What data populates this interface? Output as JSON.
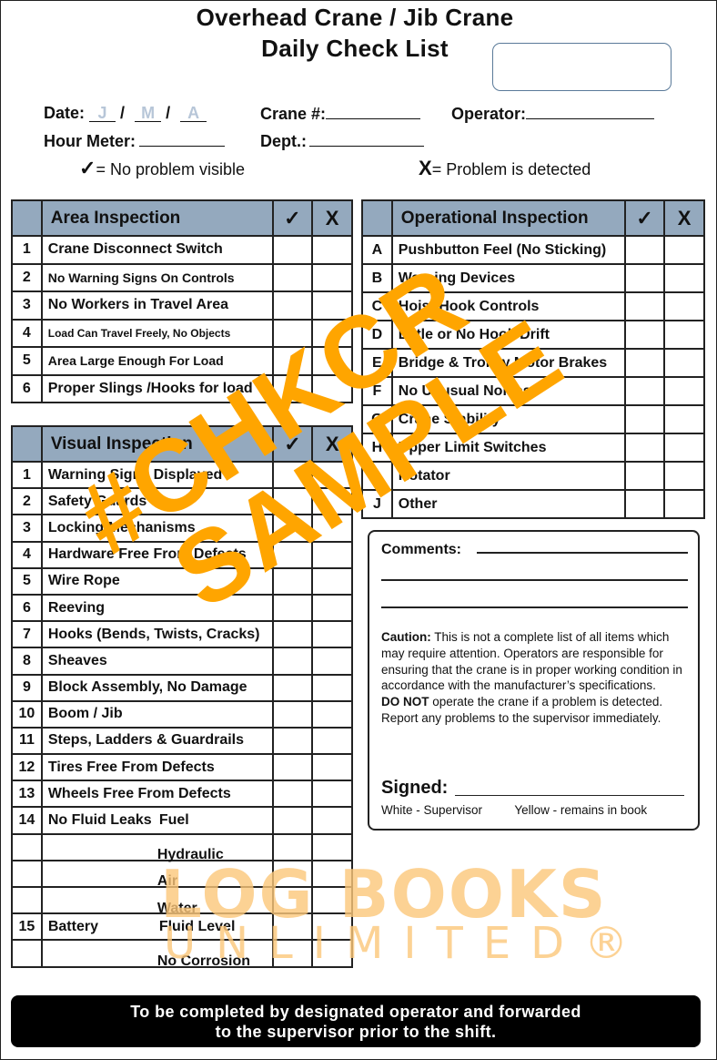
{
  "header": {
    "title_line1": "Overhead Crane / Jib Crane",
    "title_line2": "Daily Check List"
  },
  "fields": {
    "date_label": "Date:",
    "date_day_hint": "J",
    "date_month_hint": "M",
    "date_year_hint": "A",
    "date_separator": "/",
    "crane_label": "Crane #:",
    "operator_label": "Operator:",
    "hour_meter_label": "Hour Meter:",
    "dept_label": "Dept.:"
  },
  "legend": {
    "check_symbol": "✓",
    "check_text": "= No problem visible",
    "x_symbol": "X",
    "x_text": "= Problem is detected"
  },
  "area_inspection": {
    "title": "Area Inspection",
    "check_header": "✓",
    "x_header": "X",
    "rows": [
      {
        "num": "1",
        "label": "Crane Disconnect Switch"
      },
      {
        "num": "2",
        "label": "No Warning Signs On Controls"
      },
      {
        "num": "3",
        "label": "No Workers in Travel Area"
      },
      {
        "num": "4",
        "label": "Load Can Travel Freely, No Objects"
      },
      {
        "num": "5",
        "label": "Area Large Enough For Load"
      },
      {
        "num": "6",
        "label": "Proper Slings /Hooks for load"
      }
    ]
  },
  "operational_inspection": {
    "title": "Operational Inspection",
    "check_header": "✓",
    "x_header": "X",
    "rows": [
      {
        "num": "A",
        "label": "Pushbutton Feel (No Sticking)"
      },
      {
        "num": "B",
        "label": "Warning Devices"
      },
      {
        "num": "C",
        "label": "Hoist Hook Controls"
      },
      {
        "num": "D",
        "label": "Little or No Hook Drift"
      },
      {
        "num": "E",
        "label": "Bridge & Trolley Motor Brakes"
      },
      {
        "num": "F",
        "label": "No Unusual Noises"
      },
      {
        "num": "G",
        "label": "Crane Stability"
      },
      {
        "num": "H",
        "label": "Upper Limit Switches"
      },
      {
        "num": "I",
        "label": "Rotator"
      },
      {
        "num": "J",
        "label": "Other"
      }
    ]
  },
  "visual_inspection": {
    "title": "Visual Inspection",
    "check_header": "✓",
    "x_header": "X",
    "rows": [
      {
        "num": "1",
        "label": "Warning Signs Displayed",
        "sub": ""
      },
      {
        "num": "2",
        "label": "Safety Guards",
        "sub": ""
      },
      {
        "num": "3",
        "label": "Locking Mechanisms",
        "sub": ""
      },
      {
        "num": "4",
        "label": "Hardware Free From Defects",
        "sub": ""
      },
      {
        "num": "5",
        "label": "Wire Rope",
        "sub": ""
      },
      {
        "num": "6",
        "label": "Reeving",
        "sub": ""
      },
      {
        "num": "7",
        "label": "Hooks (Bends, Twists, Cracks)",
        "sub": ""
      },
      {
        "num": "8",
        "label": "Sheaves",
        "sub": ""
      },
      {
        "num": "9",
        "label": "Block Assembly, No Damage",
        "sub": ""
      },
      {
        "num": "10",
        "label": "Boom / Jib",
        "sub": ""
      },
      {
        "num": "11",
        "label": "Steps, Ladders & Guardrails",
        "sub": ""
      },
      {
        "num": "12",
        "label": "Tires Free From Defects",
        "sub": ""
      },
      {
        "num": "13",
        "label": "Wheels Free From Defects",
        "sub": ""
      },
      {
        "num": "14",
        "label": "No Fluid Leaks",
        "sub": "Fuel"
      },
      {
        "num": "",
        "label": "",
        "sub": "Hydraulic"
      },
      {
        "num": "",
        "label": "",
        "sub": "Air"
      },
      {
        "num": "",
        "label": "",
        "sub": "Water"
      },
      {
        "num": "15",
        "label": "Battery",
        "sub": "Fluid Level"
      },
      {
        "num": "",
        "label": "",
        "sub": "No Corrosion"
      }
    ]
  },
  "comments": {
    "label": "Comments:",
    "caution_bold": "Caution:",
    "caution_text": " This is not a complete list of all items which may require attention. Operators are responsible for ensuring that the crane is in proper working condition in accordance with the manufacturer’s specifications.",
    "donot_bold": "DO NOT",
    "donot_text": " operate the crane if a problem is detected. Report any problems to the supervisor immediately.",
    "signed_label": "Signed:",
    "copy_white": "White - Supervisor",
    "copy_yellow": "Yellow - remains in book"
  },
  "footer": {
    "line1": "To be completed by designated operator and forwarded",
    "line2": "to the supervisor prior to the shift."
  },
  "watermark": {
    "line1": "#CHKCR",
    "line2": "SAMPLE",
    "brand_line1": "LOG BOOKS",
    "brand_line2": "UNLIMITED®",
    "sample_color": "#FFA500",
    "brand_color": "#FCC77A"
  },
  "colors": {
    "table_header": "#94A9BE",
    "id_box_border": "#5A7A99",
    "date_hint": "#B7C6D8"
  }
}
